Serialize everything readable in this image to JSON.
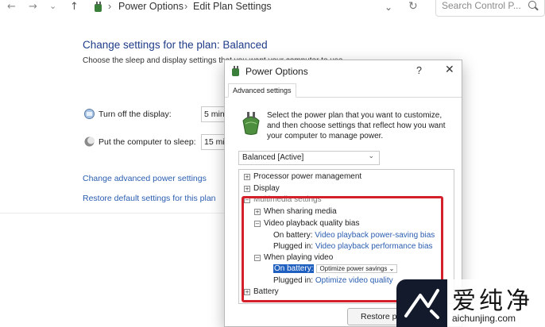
{
  "nav": {
    "back": "←",
    "forward": "→",
    "recent": "⌄",
    "up": "↑",
    "breadcrumb": [
      "Power Options",
      "Edit Plan Settings"
    ],
    "separator": "›",
    "dropdown": "⌄",
    "refresh": "↻",
    "search_placeholder": "Search Control P..."
  },
  "page": {
    "heading": "Change settings for the plan: Balanced",
    "subtext": "Choose the sleep and display settings that you want your computer to use",
    "display_label": "Turn off the display:",
    "display_value": "5 minu",
    "sleep_label": "Put the computer to sleep:",
    "sleep_value": "15 mi",
    "link_advanced": "Change advanced power settings",
    "link_restore": "Restore default settings for this plan"
  },
  "dialog": {
    "title": "Power Options",
    "help": "?",
    "close": "✕",
    "tab": "Advanced settings",
    "intro": "Select the power plan that you want to customize, and then choose settings that reflect how you want your computer to manage power.",
    "plan_selected": "Balanced [Active]",
    "plan_chevron": "⌄",
    "tree": {
      "processor": "Processor power management",
      "display": "Display",
      "multimedia": "Multimedia settings",
      "sharing": "When sharing media",
      "quality_bias": "Video playback quality bias",
      "on_battery_label": "On battery:",
      "quality_on_battery_value": "Video playback power-saving bias",
      "plugged_in_label": "Plugged in:",
      "quality_plugged_value": "Video playback performance bias",
      "playing_video": "When playing video",
      "playing_on_battery_value": "Optimize power savings",
      "playing_plugged_value": "Optimize video quality",
      "battery": "Battery"
    },
    "restore_button": "Restore p"
  },
  "watermark": {
    "chinese": "爱纯净",
    "domain": "aichunjing.com"
  },
  "colors": {
    "heading_blue": "#1f3c88",
    "link_blue": "#2a5db0",
    "highlight_red": "#d4202b",
    "selection_blue": "#1f5fbf"
  }
}
